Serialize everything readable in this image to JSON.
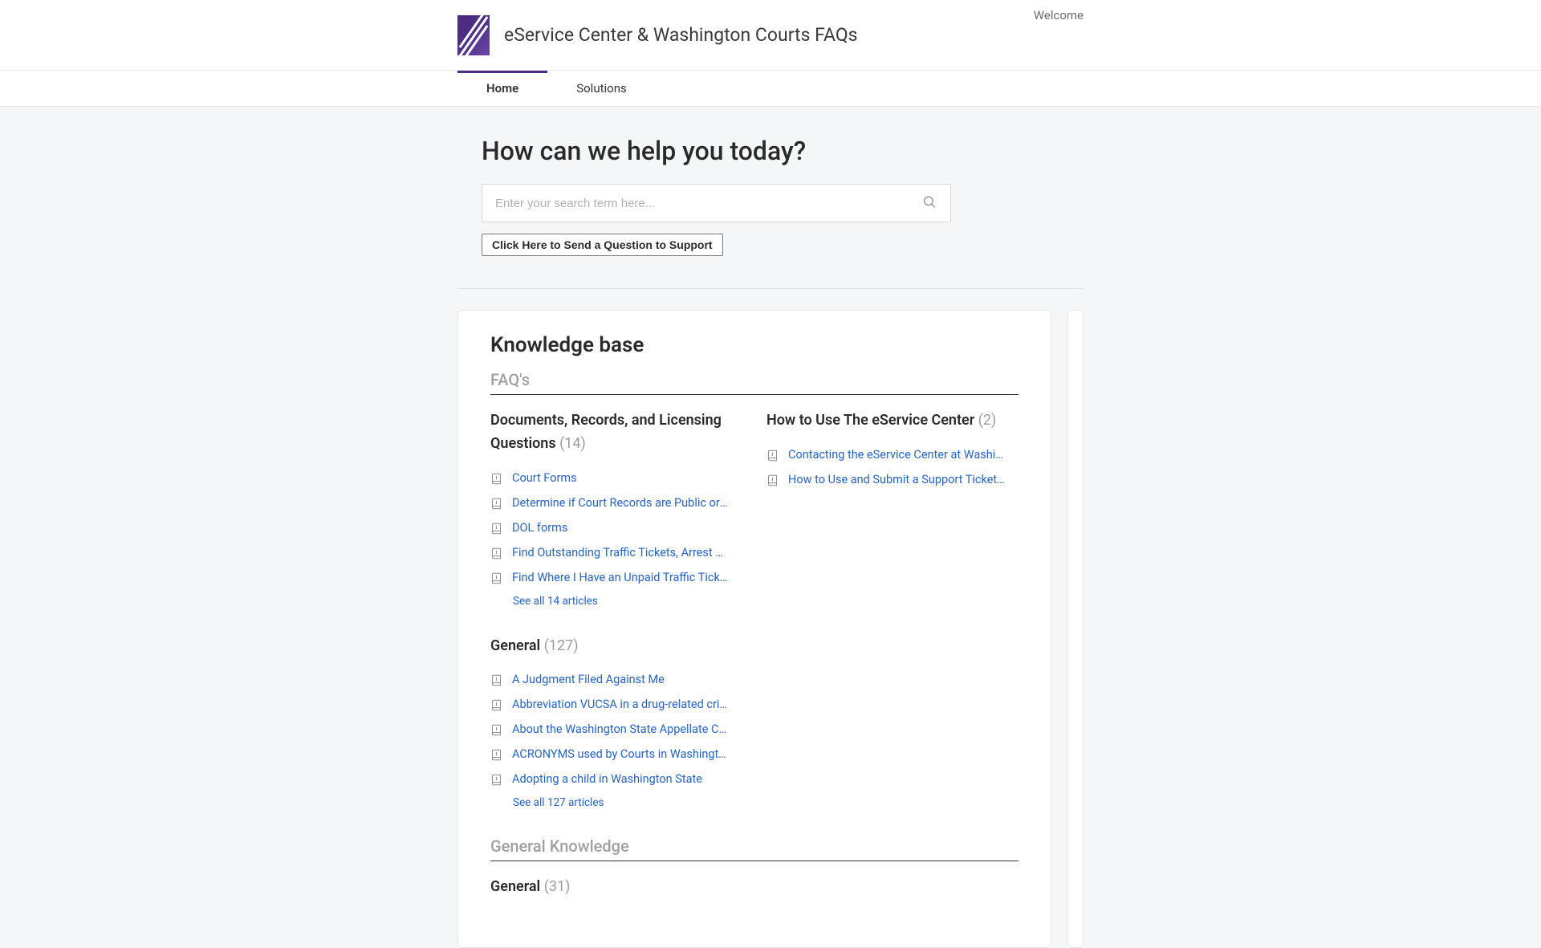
{
  "header": {
    "site_title": "eService Center & Washington Courts FAQs",
    "welcome": "Welcome"
  },
  "nav": {
    "home": "Home",
    "solutions": "Solutions"
  },
  "help_title": "How can we help you today?",
  "search": {
    "placeholder": "Enter your search term here..."
  },
  "send_question_label": "Click Here to Send a Question to Support",
  "kb": {
    "title": "Knowledge base",
    "sections": [
      {
        "heading": "FAQ's",
        "categories": [
          {
            "title": "Documents, Records, and Licensing Questions",
            "count": "(14)",
            "articles": [
              "Court Forms",
              "Determine if Court Records are Public or Pr…",
              "DOL forms",
              "Find Outstanding Traffic Tickets, Arrest War…",
              "Find Where I Have an Unpaid Traffic Ticket"
            ],
            "see_all": "See all 14 articles"
          },
          {
            "title": "How to Use The eService Center",
            "count": "(2)",
            "articles": [
              "Contacting the eService Center at Washing…",
              "How to Use and Submit a Support Ticket at …"
            ],
            "see_all": ""
          }
        ]
      },
      {
        "heading": "",
        "categories": [
          {
            "title": "General",
            "count": "(127)",
            "articles": [
              "A Judgment Filed Against Me",
              "Abbreviation VUCSA in a drug-related crime",
              "About the Washington State Appellate Cou…",
              "ACRONYMS used by Courts in Washington",
              "Adopting a child in Washington State"
            ],
            "see_all": "See all 127 articles"
          }
        ]
      },
      {
        "heading": "General Knowledge",
        "categories": [
          {
            "title": "General",
            "count": "(31)",
            "articles": [],
            "see_all": ""
          }
        ]
      }
    ]
  }
}
